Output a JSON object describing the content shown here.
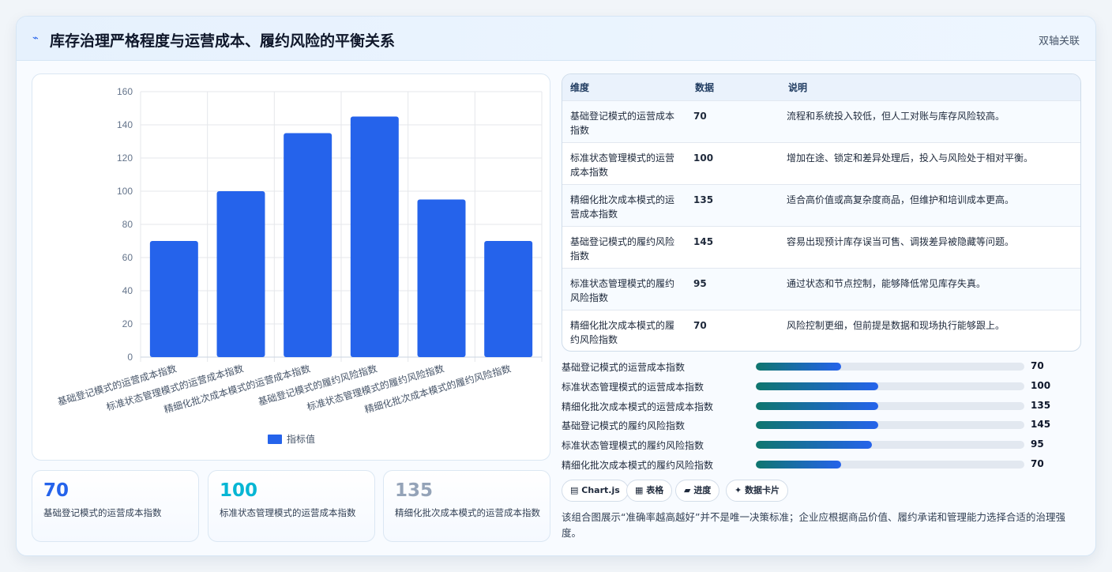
{
  "header": {
    "icon": "trend-icon",
    "title": "库存治理严格程度与运营成本、履约风险的平衡关系",
    "tag": "双轴关联"
  },
  "chart_data": {
    "type": "bar",
    "categories": [
      "基础登记模式的运营成本指数",
      "标准状态管理模式的运营成本指数",
      "精细化批次成本模式的运营成本指数",
      "基础登记模式的履约风险指数",
      "标准状态管理模式的履约风险指数",
      "精细化批次成本模式的履约风险指数"
    ],
    "series": [
      {
        "name": "指标值",
        "values": [
          70,
          100,
          135,
          145,
          95,
          70
        ],
        "color": "#2563eb"
      }
    ],
    "ylim": [
      0,
      160
    ],
    "yticks": [
      0,
      20,
      40,
      60,
      80,
      100,
      120,
      140,
      160
    ],
    "grid": true,
    "legend": "bottom"
  },
  "stats": [
    {
      "value": "70",
      "label": "基础登记模式的运营成本指数",
      "color": "#2563eb"
    },
    {
      "value": "100",
      "label": "标准状态管理模式的运营成本指数",
      "color": "#06b6d4"
    },
    {
      "value": "135",
      "label": "精细化批次成本模式的运营成本指数",
      "color": "#94a3b8"
    }
  ],
  "table": {
    "headers": [
      "维度",
      "数据",
      "说明"
    ],
    "rows": [
      [
        "基础登记模式的运营成本指数",
        "70",
        "流程和系统投入较低，但人工对账与库存风险较高。"
      ],
      [
        "标准状态管理模式的运营成本指数",
        "100",
        "增加在途、锁定和差异处理后，投入与风险处于相对平衡。"
      ],
      [
        "精细化批次成本模式的运营成本指数",
        "135",
        "适合高价值或高复杂度商品，但维护和培训成本更高。"
      ],
      [
        "基础登记模式的履约风险指数",
        "145",
        "容易出现预计库存误当可售、调拨差异被隐藏等问题。"
      ],
      [
        "标准状态管理模式的履约风险指数",
        "95",
        "通过状态和节点控制，能够降低常见库存失真。"
      ],
      [
        "精细化批次成本模式的履约风险指数",
        "70",
        "风险控制更细，但前提是数据和现场执行能够跟上。"
      ]
    ]
  },
  "progress": [
    {
      "label": "基础登记模式的运营成本指数",
      "value": "70",
      "fraction": 0.318
    },
    {
      "label": "标准状态管理模式的运营成本指数",
      "value": "100",
      "fraction": 0.455
    },
    {
      "label": "精细化批次成本模式的运营成本指数",
      "value": "135",
      "fraction": 0.455
    },
    {
      "label": "基础登记模式的履约风险指数",
      "value": "145",
      "fraction": 0.455
    },
    {
      "label": "标准状态管理模式的履约风险指数",
      "value": "95",
      "fraction": 0.432
    },
    {
      "label": "精细化批次成本模式的履约风险指数",
      "value": "70",
      "fraction": 0.318
    }
  ],
  "chips": [
    {
      "icon": "▤",
      "label": "Chart.js"
    },
    {
      "icon": "▦",
      "label": "表格"
    },
    {
      "icon": "▰",
      "label": "进度"
    },
    {
      "icon": "✦",
      "label": "数据卡片"
    }
  ],
  "note": "该组合图展示“准确率越高越好”并不是唯一决策标准；企业应根据商品价值、履约承诺和管理能力选择合适的治理强度。"
}
